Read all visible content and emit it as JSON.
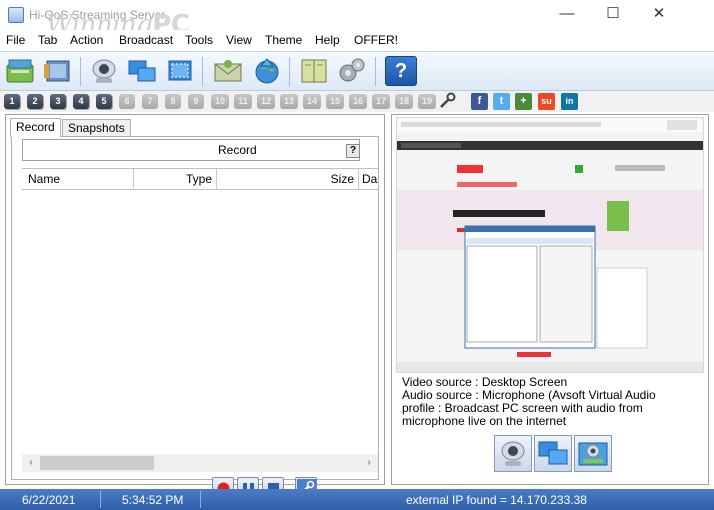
{
  "window": {
    "title": "Hi-QoS Streaming Server",
    "watermark_main": "Winning",
    "watermark_pc": "PC",
    "minimize_glyph": "—",
    "maximize_glyph": "☐",
    "close_glyph": "✕"
  },
  "menu": [
    "File",
    "Tab",
    "Action",
    "Broadcast",
    "Tools",
    "View",
    "Theme",
    "Help",
    "OFFER!"
  ],
  "toolbar": {
    "icons": [
      "open-icon",
      "film-icon",
      "webcam-icon",
      "screens-icon",
      "screen-capture-icon",
      "email-icon",
      "globe-upload-icon",
      "book-icon",
      "settings-gears-icon",
      "help-icon"
    ],
    "help_glyph": "?"
  },
  "tab_numbers": [
    "1",
    "2",
    "3",
    "4",
    "5",
    "6",
    "7",
    "8",
    "9",
    "10",
    "11",
    "12",
    "13",
    "14",
    "15",
    "16",
    "17",
    "18",
    "19"
  ],
  "active_tab_numbers": 5,
  "social": [
    {
      "name": "facebook",
      "glyph": "f",
      "color": "#3b5998"
    },
    {
      "name": "twitter",
      "glyph": "t",
      "color": "#55acee"
    },
    {
      "name": "google-plus",
      "glyph": "+",
      "color": "#4a8a3a"
    },
    {
      "name": "stumbleupon",
      "glyph": "su",
      "color": "#eb4924"
    },
    {
      "name": "linkedin",
      "glyph": "in",
      "color": "#0e76a8"
    }
  ],
  "left_panel": {
    "tabs": [
      "Record",
      "Snapshots"
    ],
    "record_label": "Record",
    "help_button": "?",
    "columns": [
      "Name",
      "Type",
      "Size",
      "Da"
    ],
    "scroll_left": "‹",
    "scroll_right": "›"
  },
  "right_panel": {
    "video_source": "Video source : Desktop Screen",
    "audio_source": "Audio source : Microphone (Avsoft Virtual Audio",
    "profile_line1": "profile : Broadcast PC screen with audio from",
    "profile_line2": "microphone live on the internet"
  },
  "status": {
    "date": "6/22/2021",
    "time": "5:34:52 PM",
    "ip": "external IP found = 14.170.233.38"
  }
}
